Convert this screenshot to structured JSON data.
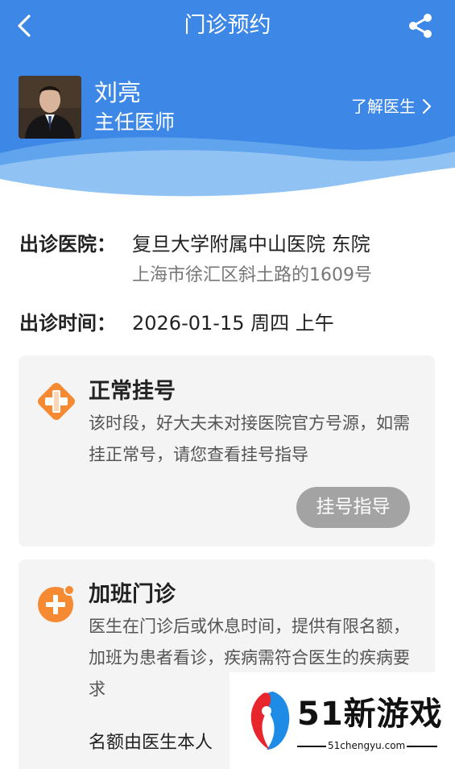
{
  "nav": {
    "title": "门诊预约"
  },
  "doctor": {
    "name": "刘亮",
    "title": "主任医师",
    "know_more": "了解医生",
    "chevron": "›"
  },
  "info": {
    "hospital_label": "出诊医院：",
    "hospital_name": "复旦大学附属中山医院 东院",
    "hospital_address": "上海市徐汇区斜土路的1609号",
    "time_label": "出诊时间：",
    "time_value": "2026-01-15 周四 上午"
  },
  "cards": {
    "normal": {
      "title": "正常挂号",
      "desc": "该时段，好大夫未对接医院官方号源，如需挂正常号，请您查看挂号指导",
      "button": "挂号指导",
      "icon": "medical-cross-diamond-icon",
      "icon_color": "#f58a32"
    },
    "extra": {
      "title": "加班门诊",
      "desc": "医生在门诊后或休息时间，提供有限名额，加班为患者看诊，疾病需符合医生的疾病要求",
      "note": "名额由医生本人",
      "icon": "plus-badge-icon",
      "icon_color": "#f58a32"
    }
  },
  "watermark": {
    "text": "51新游戏",
    "url": "51chengyu.com"
  },
  "colors": {
    "header_blue": "#3d87e6",
    "accent_orange": "#f58a32",
    "button_gray": "#a3a3a3",
    "card_bg": "#f4f4f4"
  }
}
